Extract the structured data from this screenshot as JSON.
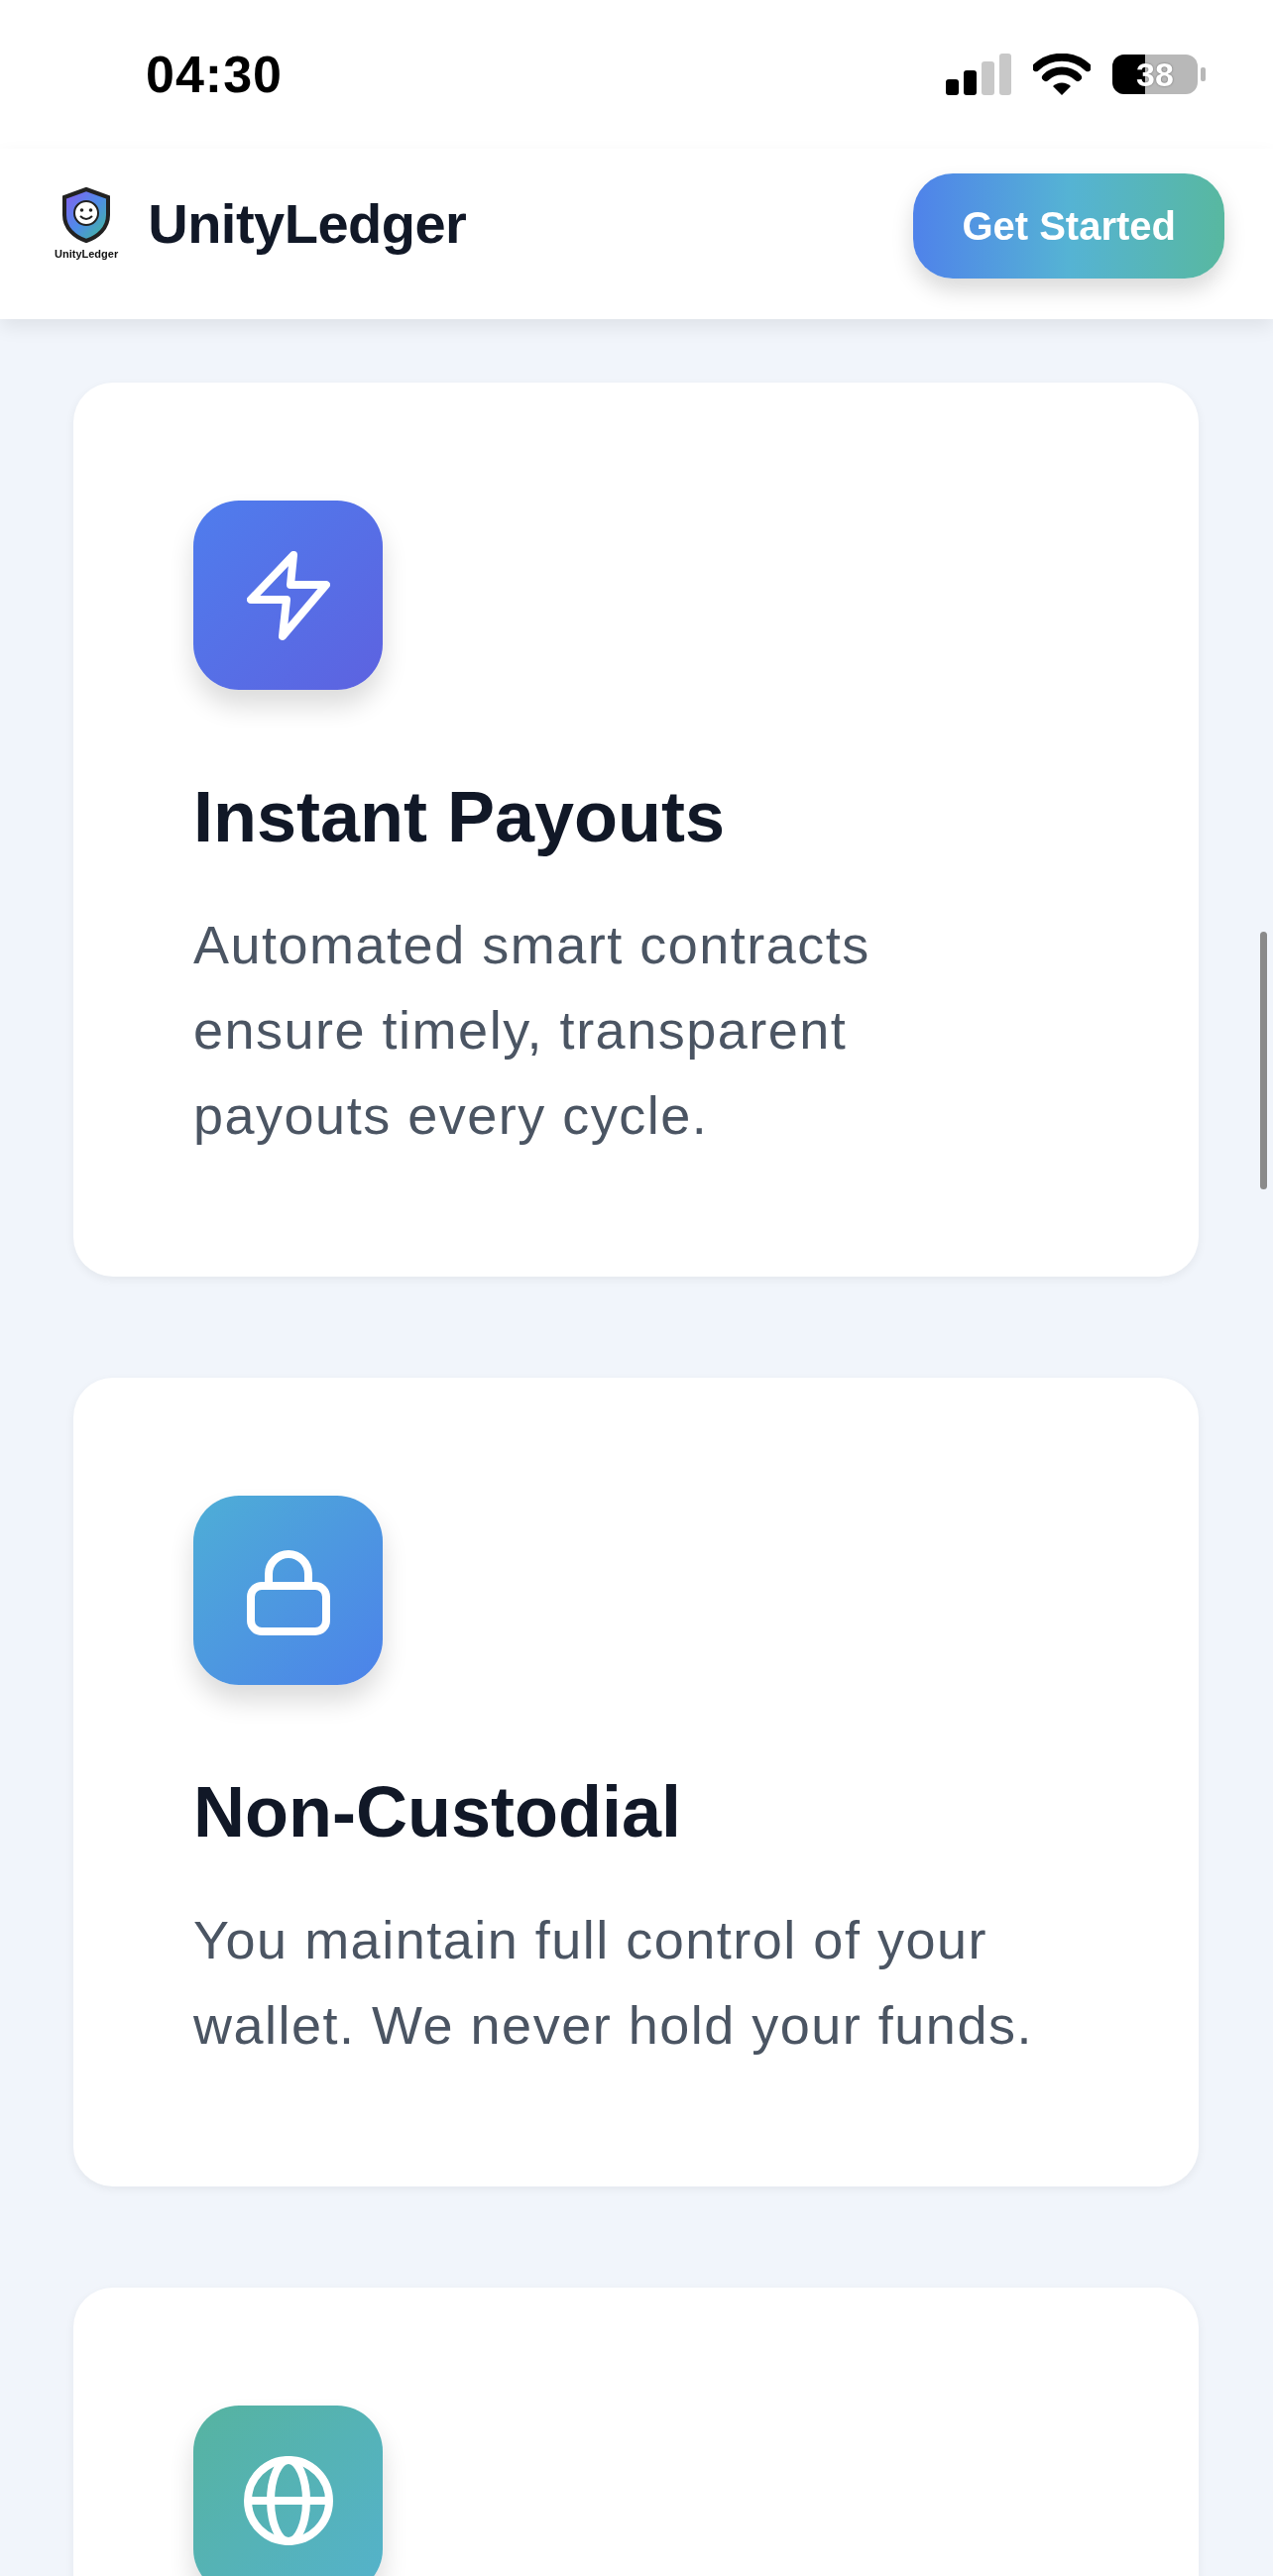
{
  "status_bar": {
    "time": "04:30",
    "battery": "38"
  },
  "header": {
    "logo_caption": "UnityLedger",
    "brand": "UnityLedger",
    "button": "Get Started"
  },
  "features": [
    {
      "kind": "bolt",
      "title": "Instant Payouts",
      "description": "Automated smart contracts ensure timely, transparent payouts every cycle."
    },
    {
      "kind": "lock",
      "title": "Non-Custodial",
      "description": "You maintain full control of your wallet. We never hold your funds."
    },
    {
      "kind": "globe"
    }
  ]
}
